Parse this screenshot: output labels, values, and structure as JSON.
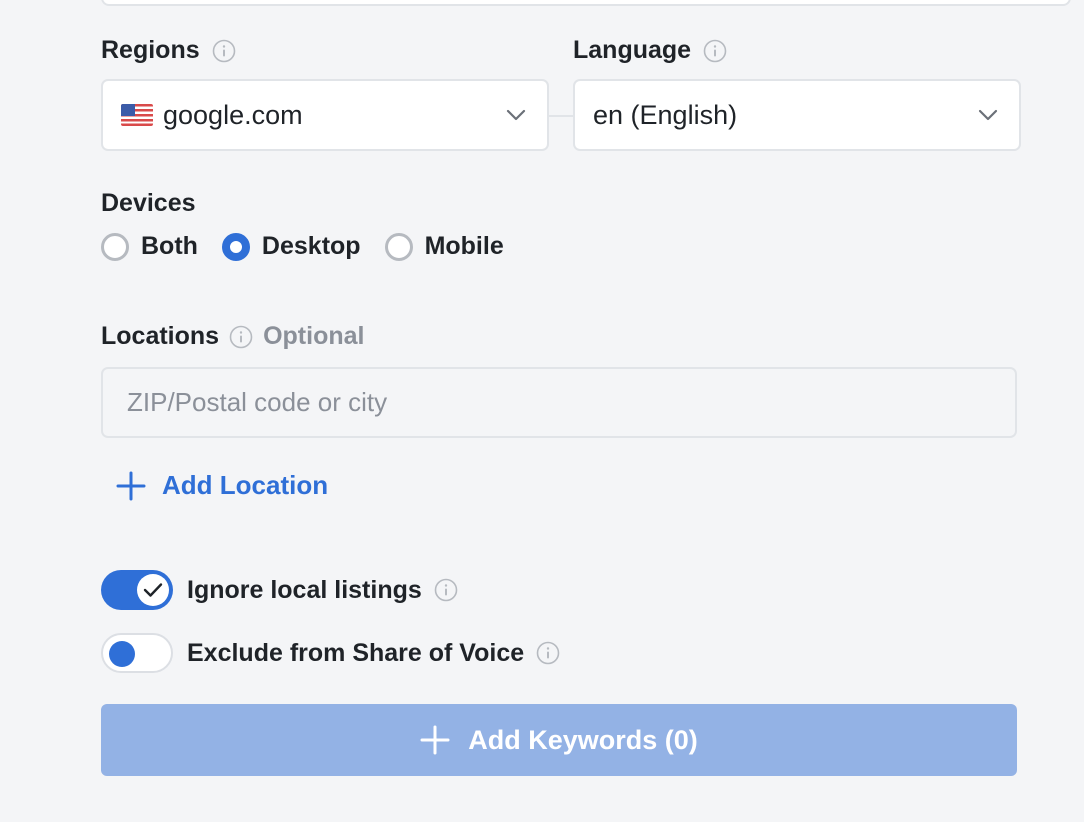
{
  "regions": {
    "label": "Regions",
    "selected": "google.com",
    "flag_icon": "us-flag-icon"
  },
  "language": {
    "label": "Language",
    "selected": "en (English)"
  },
  "devices": {
    "label": "Devices",
    "options": [
      "Both",
      "Desktop",
      "Mobile"
    ],
    "selected": "Desktop"
  },
  "locations": {
    "label": "Locations",
    "optional_label": "Optional",
    "placeholder": "ZIP/Postal code or city",
    "add_label": "Add Location"
  },
  "toggles": {
    "ignore_local": {
      "label": "Ignore local listings",
      "on": true
    },
    "exclude_sov": {
      "label": "Exclude from Share of Voice",
      "on": false
    }
  },
  "submit": {
    "label": "Add Keywords (0)"
  },
  "colors": {
    "accent": "#2f6fd7",
    "submit_disabled": "#93b2e5",
    "background": "#f4f5f7",
    "muted": "#8b9099"
  }
}
